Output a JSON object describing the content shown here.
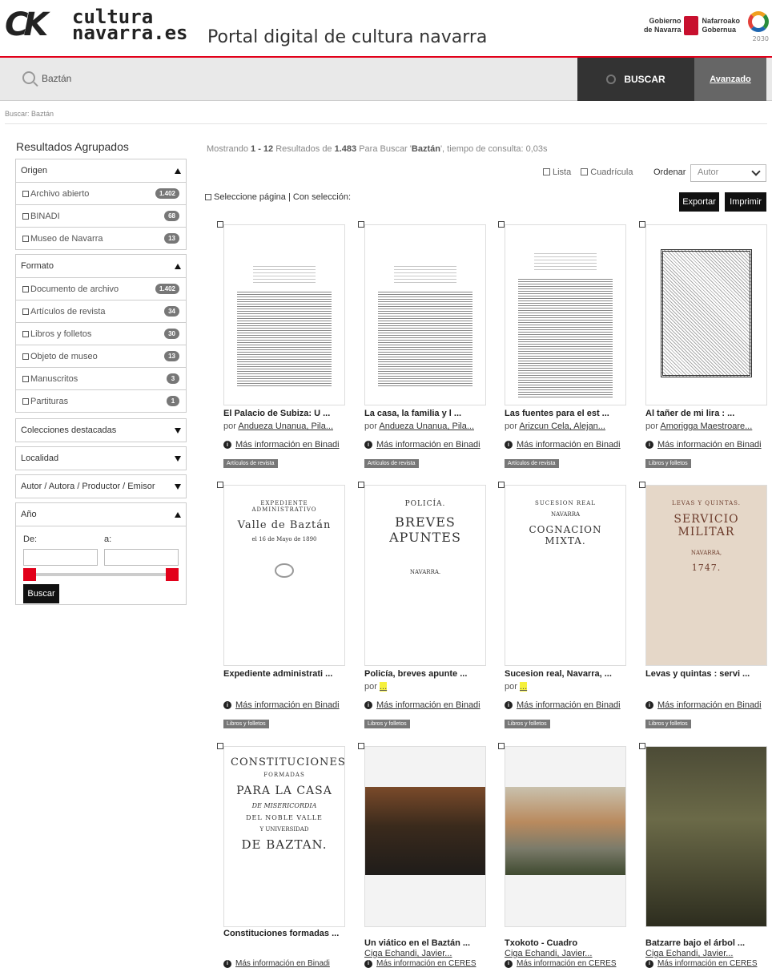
{
  "header": {
    "logo_mark": "CK",
    "logo_line1": "cultura",
    "logo_line2": "navarra.es",
    "portal_title": "Portal digital de cultura navarra",
    "gov_left_1": "Gobierno",
    "gov_left_2": "de Navarra",
    "gov_right_1": "Nafarroako",
    "gov_right_2": "Gobernua",
    "ods_year": "2030"
  },
  "search": {
    "value": "Baztán",
    "button_label": "BUSCAR",
    "advanced_label": "Avanzado",
    "breadcrumb": "Buscar: Baztán"
  },
  "sidebar": {
    "title": "Resultados Agrupados",
    "origen": {
      "label": "Origen",
      "items": [
        {
          "label": "Archivo abierto",
          "count": "1.402"
        },
        {
          "label": "BINADI",
          "count": "68"
        },
        {
          "label": "Museo de Navarra",
          "count": "13"
        }
      ]
    },
    "formato": {
      "label": "Formato",
      "items": [
        {
          "label": "Documento de archivo",
          "count": "1.402"
        },
        {
          "label": "Artículos de revista",
          "count": "34"
        },
        {
          "label": "Libros y folletos",
          "count": "30"
        },
        {
          "label": "Objeto de museo",
          "count": "13"
        },
        {
          "label": "Manuscritos",
          "count": "3"
        },
        {
          "label": "Partituras",
          "count": "1"
        }
      ]
    },
    "colecciones": "Colecciones destacadas",
    "localidad": "Localidad",
    "autor": "Autor / Autora / Productor / Emisor",
    "anio": {
      "label": "Año",
      "from_label": "De:",
      "to_label": "a:",
      "button": "Buscar"
    }
  },
  "results": {
    "summary_pre": "Mostrando ",
    "range": "1 - 12",
    "summary_mid": " Resultados de ",
    "total": "1.483",
    "summary_mid2": " Para Buscar '",
    "query": "Baztán",
    "summary_post": "', tiempo de consulta: 0,03s",
    "view_list": "Lista",
    "view_grid": "Cuadrícula",
    "order_label": "Ordenar",
    "order_value": "Autor",
    "select_page": "Seleccione página | Con selección:",
    "export": "Exportar",
    "print": "Imprimir",
    "por": "por",
    "items": [
      {
        "title": "El Palacio de Subiza: U ...",
        "author": "Andueza Unanua, Pila...",
        "info": "Más información en Binadi",
        "tag": "Artículos de revista"
      },
      {
        "title": "La casa, la familia y l ...",
        "author": "Andueza Unanua, Pila...",
        "info": "Más información en Binadi",
        "tag": "Artículos de revista"
      },
      {
        "title": "Las fuentes para el est ...",
        "author": "Arizcun Cela, Alejan...",
        "info": "Más información en Binadi",
        "tag": "Artículos de revista"
      },
      {
        "title": "Al tañer de mi lira : ...",
        "author": "Amorigga Maestroare...",
        "info": "Más información en Binadi",
        "tag": "Libros y folletos"
      },
      {
        "title": "Expediente administrati ...",
        "author": "",
        "info": "Más información en Binadi",
        "tag": "Libros y folletos"
      },
      {
        "title": "Policía, breves apunte ...",
        "author": "...",
        "info": "Más información en Binadi",
        "tag": "Libros y folletos"
      },
      {
        "title": "Sucesion real, Navarra, ...",
        "author": "...",
        "info": "Más información en Binadi",
        "tag": "Libros y folletos"
      },
      {
        "title": "Levas y quintas : servi ...",
        "author": "",
        "info": "Más información en Binadi",
        "tag": "Libros y folletos"
      },
      {
        "title": "Constituciones formadas ...",
        "author": "",
        "info": "Más información en Binadi",
        "tag": ""
      },
      {
        "title": "Un viático en el Baztán ...",
        "author": "Ciga Echandi, Javier...",
        "info": "Más información en CERES",
        "tag": ""
      },
      {
        "title": "Txokoto - Cuadro",
        "author": "Ciga Echandi, Javier...",
        "info": "Más información en CERES",
        "tag": ""
      },
      {
        "title": "Batzarre bajo el árbol ...",
        "author": "Ciga Echandi, Javier...",
        "info": "Más información en CERES",
        "tag": ""
      }
    ],
    "covers": {
      "c5": {
        "l1": "EXPEDIENTE ADMINISTRATIVO",
        "l2": "Valle de Baztán",
        "l3": "el 16 de Mayo de 1890"
      },
      "c6": {
        "l1": "POLICÍA.",
        "l2": "BREVES APUNTES",
        "l3": "NAVARRA."
      },
      "c7": {
        "l1": "SUCESION REAL",
        "l2": "NAVARRA",
        "l3": "COGNACION MIXTA."
      },
      "c8": {
        "l1": "LEVAS Y QUINTAS.",
        "l2": "SERVICIO MILITAR",
        "l3": "NAVARRA,",
        "l4": "1747."
      },
      "c9": {
        "l1": "CONSTITUCIONES",
        "l2": "FORMADAS",
        "l3": "PARA LA CASA",
        "l4": "DE MISERICORDIA",
        "l5": "DEL NOBLE VALLE",
        "l6": "Y UNIVERSIDAD",
        "l7": "DE BAZTAN."
      }
    }
  }
}
